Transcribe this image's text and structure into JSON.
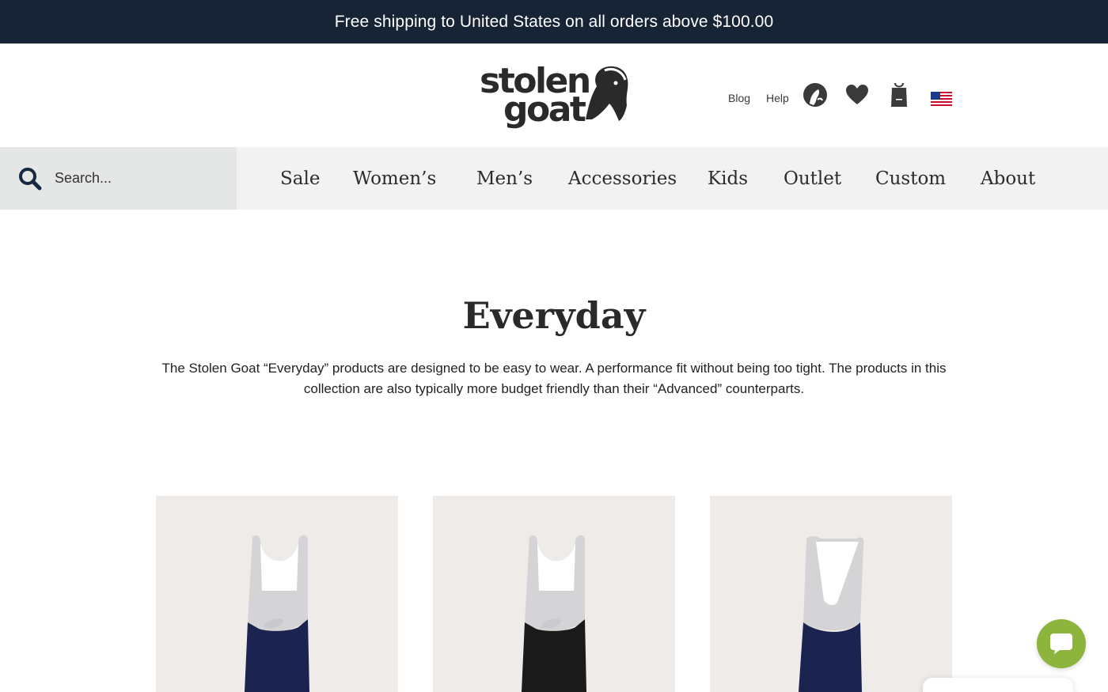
{
  "promo": {
    "text": "Free shipping to United States on all orders above $100.00"
  },
  "header": {
    "logo_line1": "stolen",
    "logo_line2": "goat",
    "blog_label": "Blog",
    "help_label": "Help",
    "icons": [
      "goat-account-icon",
      "heart-icon",
      "bag-icon",
      "us-flag-icon"
    ]
  },
  "search": {
    "placeholder": "Search..."
  },
  "nav": {
    "items": [
      {
        "label": "Sale"
      },
      {
        "label": "Women’s"
      },
      {
        "label": "Men’s"
      },
      {
        "label": "Accessories"
      },
      {
        "label": "Kids"
      },
      {
        "label": "Outlet"
      },
      {
        "label": "Custom"
      },
      {
        "label": "About"
      }
    ]
  },
  "collection": {
    "title": "Everyday",
    "description": "The Stolen Goat “Everyday” products are designed to be easy to wear. A performance fit without being too tight. The products in this collection are also typically more budget friendly than their “Advanced” counterparts."
  },
  "colors": {
    "promo_bg": "#172436",
    "nav_bg": "#f2f2f2",
    "search_bg": "#e5e6e6",
    "card_bg": "#efebe8",
    "chat_accent": "#8db43c",
    "navy_short": "#1b2350",
    "black_short": "#1a1a1a"
  }
}
